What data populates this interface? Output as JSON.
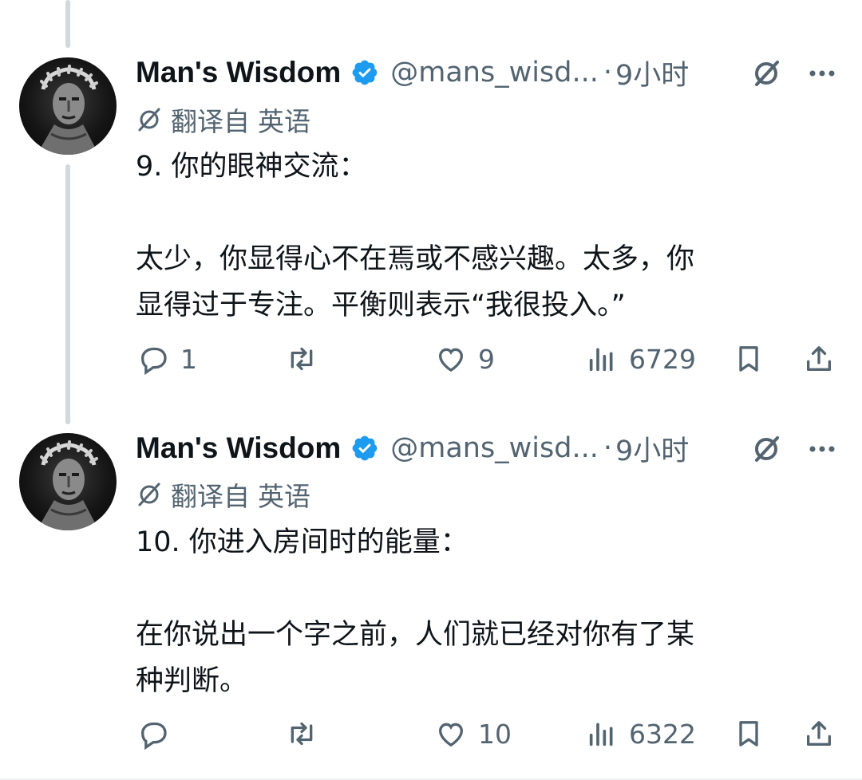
{
  "tweets": [
    {
      "author": {
        "name": "Man's Wisdom",
        "handle": "@mans_wisd...",
        "dot": "·",
        "time": "9小时"
      },
      "translation": {
        "label": "翻译自",
        "language": "英语"
      },
      "body": {
        "heading": "9. 你的眼神交流：",
        "line1": "太少，你显得心不在焉或不感兴趣。太多，你",
        "line2": "显得过于专注。平衡则表示“我很投入。”"
      },
      "stats": {
        "replies": "1",
        "retweets": "",
        "likes": "9",
        "views": "6729"
      }
    },
    {
      "author": {
        "name": "Man's Wisdom",
        "handle": "@mans_wisd...",
        "dot": "·",
        "time": "9小时"
      },
      "translation": {
        "label": "翻译自",
        "language": "英语"
      },
      "body": {
        "heading": "10. 你进入房间时的能量：",
        "line1": "在你说出一个字之前，人们就已经对你有了某",
        "line2": "种判断。"
      },
      "stats": {
        "replies": "",
        "retweets": "",
        "likes": "10",
        "views": "6322"
      }
    }
  ],
  "colors": {
    "verified": "#1d9bf0",
    "text": "#0f1419",
    "secondary": "#536471",
    "thread": "#cfd9de"
  },
  "icons": [
    "verified-badge-icon",
    "translate-icon",
    "more-icon",
    "reply-icon",
    "retweet-icon",
    "like-icon",
    "views-icon",
    "bookmark-icon",
    "share-icon"
  ]
}
